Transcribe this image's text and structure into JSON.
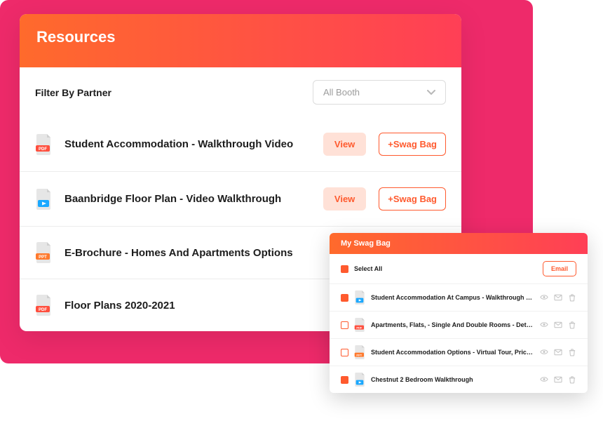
{
  "resources": {
    "title": "Resources",
    "filter_label": "Filter By Partner",
    "booth_selected": "All Booth",
    "view_label": "View",
    "swag_label": "+Swag Bag",
    "items": [
      {
        "title": "Student Accommodation - Walkthrough Video",
        "icon": "pdf",
        "has_buttons": true
      },
      {
        "title": "Baanbridge Floor Plan - Video Walkthrough",
        "icon": "video",
        "has_buttons": true
      },
      {
        "title": "E-Brochure - Homes And Apartments Options",
        "icon": "ppt",
        "has_buttons": false
      },
      {
        "title": "Floor Plans 2020-2021",
        "icon": "pdf",
        "has_buttons": false
      }
    ]
  },
  "swag": {
    "title": "My Swag Bag",
    "select_all_label": "Select All",
    "email_label": "Email",
    "items": [
      {
        "checked": true,
        "icon": "video",
        "title": "Student Accommodation At Campus - Walkthrough Video"
      },
      {
        "checked": false,
        "icon": "pdf",
        "title": "Apartments, Flats, - Single And Double Rooms - Details"
      },
      {
        "checked": false,
        "icon": "ppt",
        "title": "Student Accommodation Options - Virtual Tour, Pricing"
      },
      {
        "checked": true,
        "icon": "video",
        "title": "Chestnut 2 Bedroom Walkthrough"
      }
    ]
  },
  "colors": {
    "accent": "#ff5a2e",
    "pink": "#ee2a6a"
  }
}
